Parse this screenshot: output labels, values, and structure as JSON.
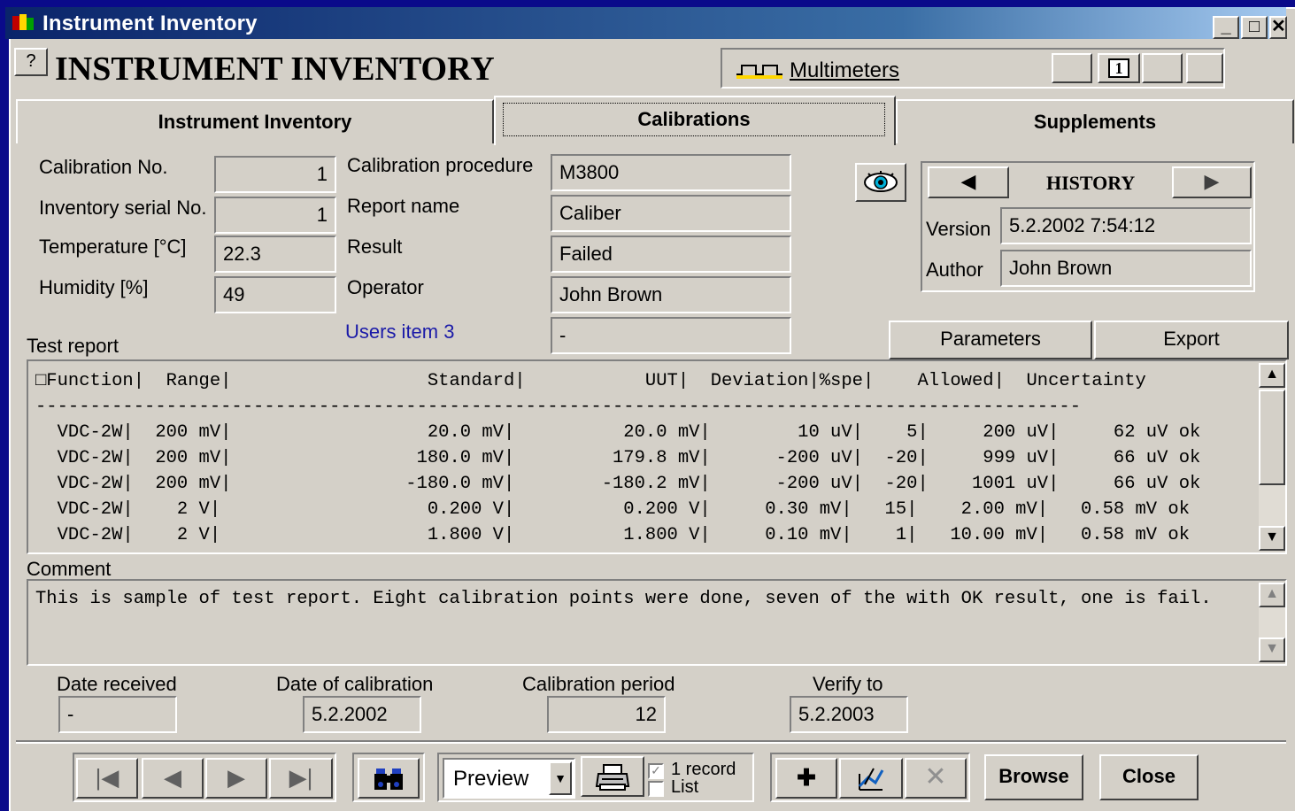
{
  "window": {
    "title": "Instrument Inventory",
    "minimize": "_",
    "maximize": "□",
    "close": "✕"
  },
  "header": {
    "help": "?",
    "heading": "INSTRUMENT INVENTORY",
    "category": "Multimeters",
    "record_button": "1"
  },
  "tabs": [
    {
      "label": "Instrument Inventory",
      "active": false
    },
    {
      "label": "Calibrations",
      "active": true
    },
    {
      "label": "Supplements",
      "active": false
    }
  ],
  "form": {
    "calibration_no": {
      "label": "Calibration No.",
      "value": "1"
    },
    "inventory_serial_no": {
      "label": "Inventory serial No.",
      "value": "1"
    },
    "temperature": {
      "label": "Temperature  [°C]",
      "value": "22.3"
    },
    "humidity": {
      "label": "Humidity  [%]",
      "value": "49"
    },
    "calibration_procedure": {
      "label": "Calibration procedure",
      "value": "M3800"
    },
    "report_name": {
      "label": "Report name",
      "value": "Caliber"
    },
    "result": {
      "label": "Result",
      "value": "Failed"
    },
    "operator": {
      "label": "Operator",
      "value": "John Brown"
    },
    "users_item_3": {
      "label": "Users item 3",
      "value": "-"
    }
  },
  "history": {
    "title": "HISTORY",
    "version_label": "Version",
    "version_value": "5.2.2002 7:54:12",
    "author_label": "Author",
    "author_value": "John Brown"
  },
  "buttons": {
    "parameters": "Parameters",
    "export": "Export",
    "browse": "Browse",
    "close": "Close"
  },
  "test_report": {
    "label": "Test report",
    "header": "□Function|  Range|                  Standard|           UUT|  Deviation|%spe|    Allowed|  Uncertainty",
    "separator": "------------------------------------------------------------------------------------------------",
    "rows": [
      "  VDC-2W|  200 mV|                  20.0 mV|          20.0 mV|        10 uV|    5|     200 uV|     62 uV ok",
      "  VDC-2W|  200 mV|                 180.0 mV|         179.8 mV|      -200 uV|  -20|     999 uV|     66 uV ok",
      "  VDC-2W|  200 mV|                -180.0 mV|        -180.2 mV|      -200 uV|  -20|    1001 uV|     66 uV ok",
      "  VDC-2W|    2 V|                   0.200 V|          0.200 V|     0.30 mV|   15|    2.00 mV|   0.58 mV ok",
      "  VDC-2W|    2 V|                   1.800 V|          1.800 V|     0.10 mV|    1|   10.00 mV|   0.58 mV ok"
    ]
  },
  "comment": {
    "label": "Comment",
    "text": "This is sample of test report. Eight calibration points were done, seven of the with OK result, one is fail."
  },
  "dates": {
    "date_received": {
      "label": "Date received",
      "value": "-"
    },
    "date_of_calibration": {
      "label": "Date of calibration",
      "value": "5.2.2002"
    },
    "calibration_period": {
      "label": "Calibration period",
      "value": "12"
    },
    "verify_to": {
      "label": "Verify to",
      "value": "5.2.2003"
    }
  },
  "toolbar": {
    "output_select": "Preview",
    "checkbox_1_record": "1 record",
    "checkbox_list": "List",
    "first": "first-record-icon",
    "prev": "prev-record-icon",
    "next": "next-record-icon",
    "last": "last-record-icon",
    "search": "binoculars-icon",
    "print": "printer-icon",
    "add": "plus-icon",
    "edit": "edit-icon",
    "delete": "delete-icon"
  }
}
